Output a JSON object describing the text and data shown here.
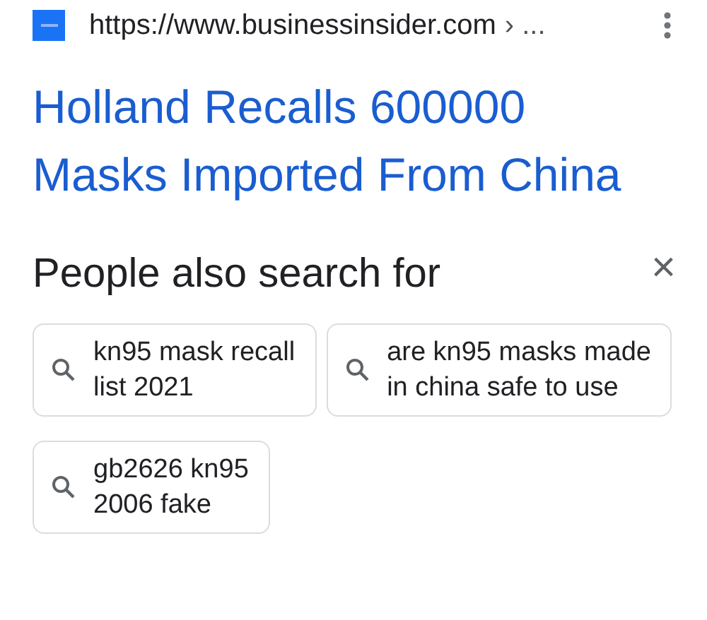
{
  "result": {
    "url": "https://www.businessinsider.com",
    "breadcrumb": "› ...",
    "title": "Holland Recalls 600000 Masks Imported From China"
  },
  "people_also_search": {
    "heading": "People also search for",
    "close": "×",
    "chips": [
      {
        "text": "kn95 mask recall\nlist 2021"
      },
      {
        "text": "are kn95 masks made\nin china safe to use"
      },
      {
        "text": "gb2626 kn95\n2006 fake"
      }
    ]
  }
}
